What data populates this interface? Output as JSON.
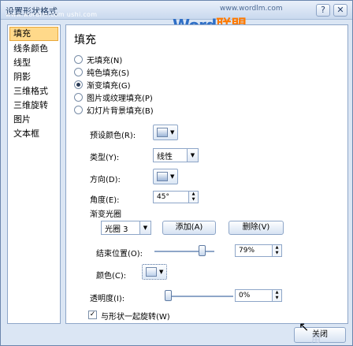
{
  "window": {
    "title": "设置形状格式",
    "site": "www.wordlm.com  ushi.com",
    "watermark_url": "www.wordlm.com",
    "watermark_logo_a": "Word",
    "watermark_logo_b": "联盟",
    "help_icon": "?",
    "close_icon": "✕"
  },
  "nav": {
    "items": [
      {
        "label": "填充",
        "selected": true
      },
      {
        "label": "线条颜色"
      },
      {
        "label": "线型"
      },
      {
        "label": "阴影"
      },
      {
        "label": "三维格式"
      },
      {
        "label": "三维旋转"
      },
      {
        "label": "图片"
      },
      {
        "label": "文本框"
      }
    ]
  },
  "panel": {
    "title": "填充",
    "fill_options": [
      {
        "label": "无填充(N)",
        "checked": false
      },
      {
        "label": "纯色填充(S)",
        "checked": false
      },
      {
        "label": "渐变填充(G)",
        "checked": true
      },
      {
        "label": "图片或纹理填充(P)",
        "checked": false
      },
      {
        "label": "幻灯片背景填充(B)",
        "checked": false
      }
    ],
    "preset_colors_label": "预设颜色(R):",
    "type_label": "类型(Y):",
    "type_value": "线性",
    "direction_label": "方向(D):",
    "angle_label": "角度(E):",
    "angle_value": "45°",
    "gradient_stops_label": "渐变光圈",
    "stop_value": "光圈 3",
    "add_button": "添加(A)",
    "delete_button": "删除(V)",
    "end_position_label": "结束位置(O):",
    "end_position_value": "79%",
    "end_position_fraction": 0.79,
    "color_label": "颜色(C):",
    "transparency_label": "透明度(I):",
    "transparency_value": "0%",
    "transparency_fraction": 0.0,
    "rotate_with_shape_label": "与形状一起旋转(W)",
    "rotate_with_shape_checked": true,
    "dropdown_arrow": "▼",
    "spin_up": "▲",
    "spin_down": "▼",
    "check_mark": "✓"
  },
  "footer": {
    "close_button": "关闭",
    "corner_watermark": "用"
  }
}
